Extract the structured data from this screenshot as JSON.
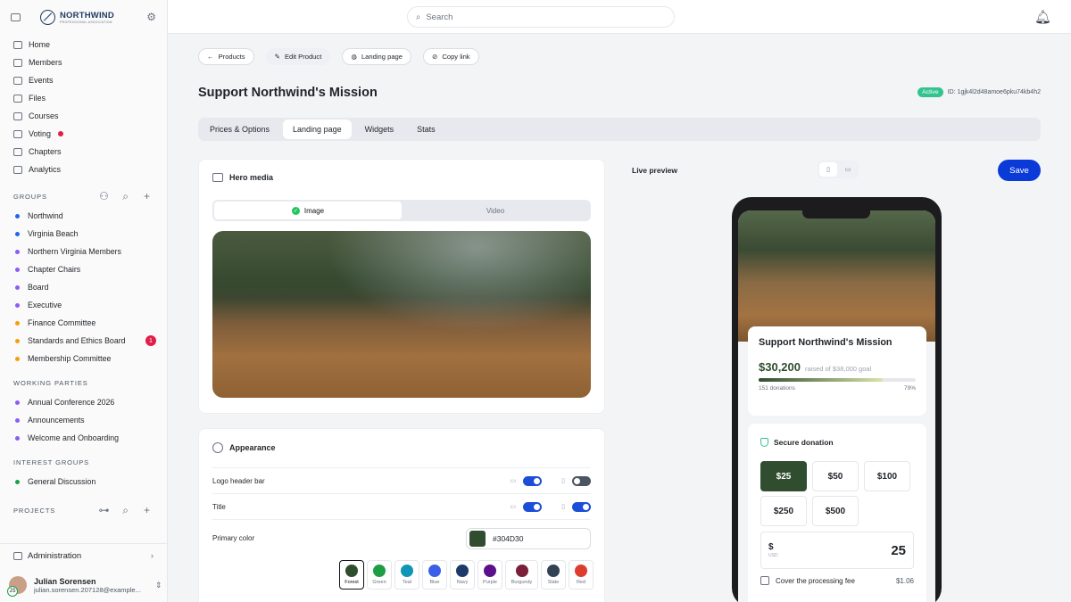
{
  "app": {
    "logo_text": "NORTHWIND",
    "logo_subtext": "PROFESSIONAL ASSOCIATION"
  },
  "sidebar": {
    "nav": [
      {
        "label": "Home",
        "icon": "home-icon"
      },
      {
        "label": "Members",
        "icon": "members-icon"
      },
      {
        "label": "Events",
        "icon": "calendar-icon"
      },
      {
        "label": "Files",
        "icon": "files-icon"
      },
      {
        "label": "Courses",
        "icon": "book-icon"
      },
      {
        "label": "Voting",
        "icon": "voting-icon"
      },
      {
        "label": "Chapters",
        "icon": "chapters-icon"
      },
      {
        "label": "Analytics",
        "icon": "chart-icon"
      }
    ],
    "groups_title": "GROUPS",
    "groups": [
      {
        "label": "Northwind",
        "color": "#2563eb"
      },
      {
        "label": "Virginia Beach",
        "color": "#2563eb"
      },
      {
        "label": "Northern Virginia Members",
        "color": "#8b5cf6"
      },
      {
        "label": "Chapter Chairs",
        "color": "#8b5cf6"
      },
      {
        "label": "Board",
        "color": "#8b5cf6"
      },
      {
        "label": "Executive",
        "color": "#8b5cf6"
      },
      {
        "label": "Finance Committee",
        "color": "#f59e0b"
      },
      {
        "label": "Standards and Ethics Board",
        "color": "#f59e0b",
        "badge": "1"
      },
      {
        "label": "Membership Committee",
        "color": "#f59e0b"
      }
    ],
    "working_title": "WORKING PARTIES",
    "working": [
      {
        "label": "Annual Conference 2026",
        "color": "#8b5cf6"
      },
      {
        "label": "Announcements",
        "color": "#8b5cf6"
      },
      {
        "label": "Welcome and Onboarding",
        "color": "#8b5cf6"
      }
    ],
    "interest_title": "INTEREST GROUPS",
    "interest": [
      {
        "label": "General Discussion",
        "color": "#16a34a"
      }
    ],
    "projects_title": "PROJECTS",
    "admin_label": "Administration",
    "user_name": "Julian Sorensen",
    "user_email": "julian.sorensen.207128@example...",
    "user_badge": "JS"
  },
  "topbar": {
    "search_placeholder": "Search"
  },
  "header": {
    "back_label": "Products",
    "pills": [
      "Edit Product",
      "Landing page",
      "Copy link"
    ],
    "title": "Support Northwind's Mission",
    "status": "Active",
    "id_text": "ID: 1gjk4l2d48amoe6pku74kb4h2"
  },
  "tabs": [
    "Prices & Options",
    "Landing page",
    "Widgets",
    "Stats"
  ],
  "hero_card": {
    "title": "Hero media",
    "option_image": "Image",
    "option_video": "Video"
  },
  "appearance": {
    "title": "Appearance",
    "logo_header_bar": "Logo header bar",
    "title_label": "Title",
    "primary_color_label": "Primary color",
    "primary_color_value": "#304D30",
    "swatches": [
      {
        "label": "Forest",
        "color": "#304D30"
      },
      {
        "label": "Green",
        "color": "#1f9d45"
      },
      {
        "label": "Teal",
        "color": "#0e96b5"
      },
      {
        "label": "Blue",
        "color": "#3b5ee8"
      },
      {
        "label": "Navy",
        "color": "#1e3a6b"
      },
      {
        "label": "Purple",
        "color": "#5b0f8a"
      },
      {
        "label": "Burgundy",
        "color": "#7a1f3a"
      },
      {
        "label": "Slate",
        "color": "#334155"
      },
      {
        "label": "Red",
        "color": "#dc3d2e"
      }
    ]
  },
  "preview": {
    "label": "Live preview",
    "save": "Save",
    "title": "Support Northwind's Mission",
    "raised": "$30,200",
    "goal_text": "raised of $38,000 goal",
    "donations": "151 donations",
    "percent": "79%",
    "progress": 0.79,
    "secure": "Secure donation",
    "amounts": [
      "$25",
      "$50",
      "$100",
      "$250",
      "$500"
    ],
    "currency_symbol": "$",
    "currency_code": "USD",
    "custom_amount": "25",
    "fee_label": "Cover the processing fee",
    "fee_amount": "$1.06"
  }
}
